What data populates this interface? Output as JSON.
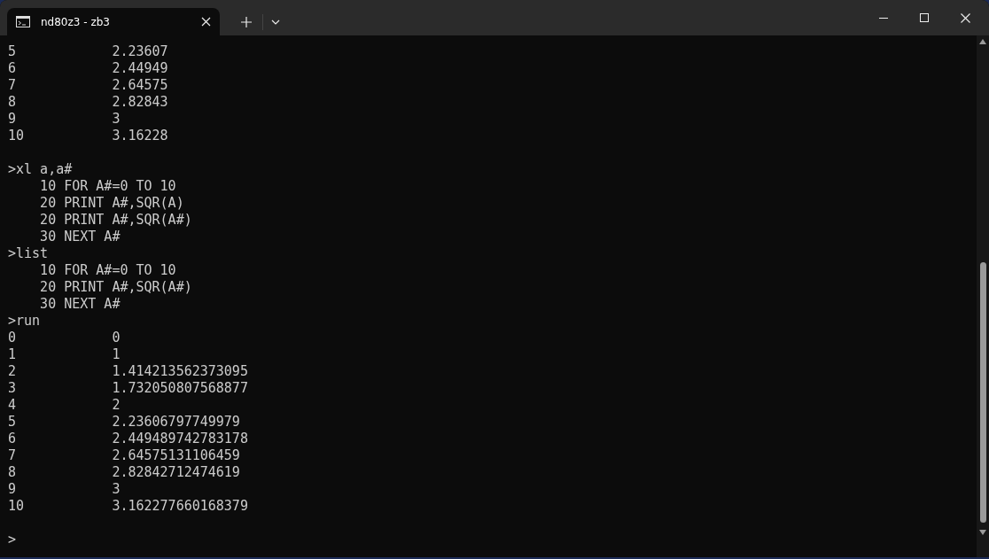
{
  "tab": {
    "title": "nd80z3 - zb3",
    "selected": true
  },
  "terminal_lines": [
    {
      "kind": "text",
      "text": "5            2.23607"
    },
    {
      "kind": "text",
      "text": "6            2.44949"
    },
    {
      "kind": "text",
      "text": "7            2.64575"
    },
    {
      "kind": "text",
      "text": "8            2.82843"
    },
    {
      "kind": "text",
      "text": "9            3"
    },
    {
      "kind": "text",
      "text": "10           3.16228"
    },
    {
      "kind": "blank"
    },
    {
      "kind": "text",
      "text": ">xl a,a#"
    },
    {
      "kind": "text",
      "text": "    10 FOR A#=0 TO 10"
    },
    {
      "kind": "text",
      "text": "    20 PRINT A#,SQR(A)"
    },
    {
      "kind": "text",
      "text": "    20 PRINT A#,SQR(A#)"
    },
    {
      "kind": "text",
      "text": "    30 NEXT A#"
    },
    {
      "kind": "text",
      "text": ">list"
    },
    {
      "kind": "text",
      "text": "    10 FOR A#=0 TO 10"
    },
    {
      "kind": "text",
      "text": "    20 PRINT A#,SQR(A#)"
    },
    {
      "kind": "text",
      "text": "    30 NEXT A#"
    },
    {
      "kind": "text",
      "text": ">run"
    },
    {
      "kind": "text",
      "text": "0            0"
    },
    {
      "kind": "text",
      "text": "1            1"
    },
    {
      "kind": "text",
      "text": "2            1.414213562373095"
    },
    {
      "kind": "text",
      "text": "3            1.732050807568877"
    },
    {
      "kind": "text",
      "text": "4            2"
    },
    {
      "kind": "text",
      "text": "5            2.23606797749979"
    },
    {
      "kind": "text",
      "text": "6            2.449489742783178"
    },
    {
      "kind": "text",
      "text": "7            2.64575131106459"
    },
    {
      "kind": "text",
      "text": "8            2.82842712474619"
    },
    {
      "kind": "text",
      "text": "9            3"
    },
    {
      "kind": "text",
      "text": "10           3.162277660168379"
    },
    {
      "kind": "blank"
    },
    {
      "kind": "text",
      "text": ">"
    }
  ]
}
